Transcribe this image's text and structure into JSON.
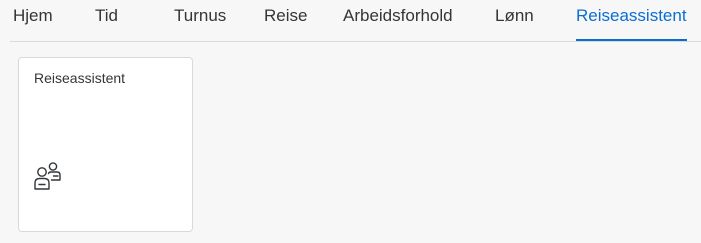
{
  "tabs": [
    {
      "label": "Hjem",
      "active": false
    },
    {
      "label": "Tid",
      "active": false
    },
    {
      "label": "Turnus",
      "active": false
    },
    {
      "label": "Reise",
      "active": false
    },
    {
      "label": "Arbeidsforhold",
      "active": false
    },
    {
      "label": "Lønn",
      "active": false
    },
    {
      "label": "Reiseassistent",
      "active": true
    }
  ],
  "tile": {
    "title": "Reiseassistent",
    "icon": "travel-assistant-icon"
  },
  "colors": {
    "accent": "#0a6ed1",
    "background": "#f7f7f7",
    "tile_background": "#ffffff",
    "text": "#32363a"
  }
}
